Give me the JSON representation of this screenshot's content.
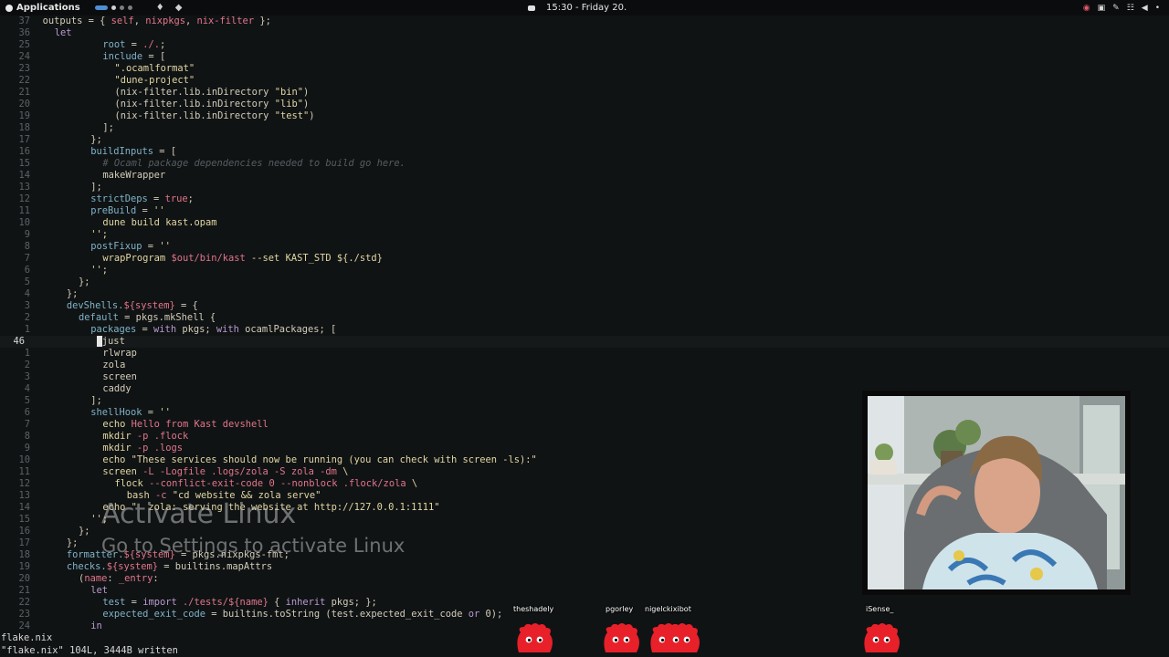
{
  "topbar": {
    "apps_label": "Applications",
    "clock": "15:30 - Friday 20.",
    "icons_left": [
      "droplet-icon",
      "diamond-icon"
    ],
    "tray_icons": [
      "record-icon",
      "gamepad-icon",
      "pen-icon",
      "network-icon",
      "volume-icon",
      "mic-icon"
    ]
  },
  "editor": {
    "lines": [
      {
        "n": "37",
        "c": [
          [
            "",
            "outputs = { "
          ],
          [
            "t-int",
            "self"
          ],
          [
            "",
            ", "
          ],
          [
            "t-int",
            "nixpkgs"
          ],
          [
            "",
            ", "
          ],
          [
            "t-int",
            "nix-filter"
          ],
          [
            "",
            " };"
          ]
        ],
        "indent": 1
      },
      {
        "n": "36",
        "c": [
          [
            "t-kw",
            "let"
          ]
        ],
        "indent": 3
      },
      {
        "n": "25",
        "c": [
          [
            "t-attr",
            "root"
          ],
          [
            "",
            " = "
          ],
          [
            "t-int",
            "./."
          ],
          [
            "",
            ";"
          ]
        ],
        "indent": 11
      },
      {
        "n": "24",
        "c": [
          [
            "t-attr",
            "include"
          ],
          [
            "",
            " = ["
          ]
        ],
        "indent": 11
      },
      {
        "n": "23",
        "c": [
          [
            "t-str",
            "\".ocamlformat\""
          ]
        ],
        "indent": 13
      },
      {
        "n": "22",
        "c": [
          [
            "t-str",
            "\"dune-project\""
          ]
        ],
        "indent": 13
      },
      {
        "n": "21",
        "c": [
          [
            "",
            "(nix-filter.lib.inDirectory "
          ],
          [
            "t-str",
            "\"bin\""
          ],
          [
            "",
            ")"
          ]
        ],
        "indent": 13
      },
      {
        "n": "20",
        "c": [
          [
            "",
            "(nix-filter.lib.inDirectory "
          ],
          [
            "t-str",
            "\"lib\""
          ],
          [
            "",
            ")"
          ]
        ],
        "indent": 13
      },
      {
        "n": "19",
        "c": [
          [
            "",
            "(nix-filter.lib.inDirectory "
          ],
          [
            "t-str",
            "\"test\""
          ],
          [
            "",
            ")"
          ]
        ],
        "indent": 13
      },
      {
        "n": "18",
        "c": [
          [
            "",
            "];"
          ]
        ],
        "indent": 11
      },
      {
        "n": "17",
        "c": [
          [
            "",
            "};"
          ]
        ],
        "indent": 9
      },
      {
        "n": "16",
        "c": [
          [
            "t-attr",
            "buildInputs"
          ],
          [
            "",
            " = ["
          ]
        ],
        "indent": 9
      },
      {
        "n": "15",
        "c": [
          [
            "t-com",
            "# Ocaml package dependencies needed to build go here."
          ]
        ],
        "indent": 11
      },
      {
        "n": "14",
        "c": [
          [
            "",
            "makeWrapper"
          ]
        ],
        "indent": 11
      },
      {
        "n": "13",
        "c": [
          [
            "",
            "];"
          ]
        ],
        "indent": 9
      },
      {
        "n": "12",
        "c": [
          [
            "t-attr",
            "strictDeps"
          ],
          [
            "",
            " = "
          ],
          [
            "t-int",
            "true"
          ],
          [
            "",
            ";"
          ]
        ],
        "indent": 9
      },
      {
        "n": "11",
        "c": [
          [
            "t-attr",
            "preBuild"
          ],
          [
            "",
            " = "
          ],
          [
            "t-str",
            "''"
          ]
        ],
        "indent": 9
      },
      {
        "n": "10",
        "c": [
          [
            "t-cmd",
            "dune build kast.opam"
          ]
        ],
        "indent": 11
      },
      {
        "n": "9",
        "c": [
          [
            "t-str",
            "'';"
          ]
        ],
        "indent": 9
      },
      {
        "n": "8",
        "c": [
          [
            "t-attr",
            "postFixup"
          ],
          [
            "",
            " = "
          ],
          [
            "t-str",
            "''"
          ]
        ],
        "indent": 9
      },
      {
        "n": "7",
        "c": [
          [
            "t-cmd",
            "wrapProgram "
          ],
          [
            "t-int",
            "$out/bin/kast"
          ],
          [
            "t-cmd",
            " --set KAST_STD ${./std}"
          ]
        ],
        "indent": 11
      },
      {
        "n": "6",
        "c": [
          [
            "t-str",
            "'';"
          ]
        ],
        "indent": 9
      },
      {
        "n": "5",
        "c": [
          [
            "",
            "};"
          ]
        ],
        "indent": 7
      },
      {
        "n": "4",
        "c": [
          [
            "",
            "};"
          ]
        ],
        "indent": 5
      },
      {
        "n": "3",
        "c": [
          [
            "t-attr",
            "devShells."
          ],
          [
            "t-int",
            "${system}"
          ],
          [
            "",
            " = {"
          ]
        ],
        "indent": 5
      },
      {
        "n": "2",
        "c": [
          [
            "t-attr",
            "default"
          ],
          [
            "",
            " = pkgs.mkShell {"
          ]
        ],
        "indent": 7
      },
      {
        "n": "1",
        "c": [
          [
            "t-attr",
            "packages"
          ],
          [
            "",
            " = "
          ],
          [
            "t-kw",
            "with"
          ],
          [
            "",
            " pkgs; "
          ],
          [
            "t-kw",
            "with"
          ],
          [
            "",
            " ocamlPackages; ["
          ]
        ],
        "indent": 9
      },
      {
        "n": "46",
        "c": [
          [
            "",
            "just"
          ]
        ],
        "indent": 11,
        "current": true
      },
      {
        "n": "1",
        "c": [
          [
            "",
            "rlwrap"
          ]
        ],
        "indent": 11
      },
      {
        "n": "2",
        "c": [
          [
            "",
            "zola"
          ]
        ],
        "indent": 11
      },
      {
        "n": "3",
        "c": [
          [
            "",
            "screen"
          ]
        ],
        "indent": 11
      },
      {
        "n": "4",
        "c": [
          [
            "",
            "caddy"
          ]
        ],
        "indent": 11
      },
      {
        "n": "5",
        "c": [
          [
            "",
            "];"
          ]
        ],
        "indent": 9
      },
      {
        "n": "6",
        "c": [
          [
            "t-attr",
            "shellHook"
          ],
          [
            "",
            " = "
          ],
          [
            "t-str",
            "''"
          ]
        ],
        "indent": 9
      },
      {
        "n": "7",
        "c": [
          [
            "t-cmd",
            "echo "
          ],
          [
            "t-int",
            "Hello from Kast devshell"
          ]
        ],
        "indent": 11
      },
      {
        "n": "8",
        "c": [
          [
            "t-cmd",
            "mkdir "
          ],
          [
            "t-int",
            "-p .flock"
          ]
        ],
        "indent": 11
      },
      {
        "n": "9",
        "c": [
          [
            "t-cmd",
            "mkdir "
          ],
          [
            "t-int",
            "-p .logs"
          ]
        ],
        "indent": 11
      },
      {
        "n": "10",
        "c": [
          [
            "t-cmd",
            "echo \"These services should now be running (you can check with screen -ls):\""
          ]
        ],
        "indent": 11
      },
      {
        "n": "11",
        "c": [
          [
            "t-cmd",
            "screen "
          ],
          [
            "t-int",
            "-L -Logfile .logs/zola -S zola -dm"
          ],
          [
            "t-cmd",
            " \\"
          ]
        ],
        "indent": 11
      },
      {
        "n": "12",
        "c": [
          [
            "t-cmd",
            "flock "
          ],
          [
            "t-int",
            "--conflict-exit-code 0 --nonblock .flock/zola"
          ],
          [
            "t-cmd",
            " \\"
          ]
        ],
        "indent": 13
      },
      {
        "n": "13",
        "c": [
          [
            "t-cmd",
            "bash "
          ],
          [
            "t-int",
            "-c"
          ],
          [
            "t-cmd",
            " \"cd website && zola serve\""
          ]
        ],
        "indent": 15
      },
      {
        "n": "14",
        "c": [
          [
            "t-cmd",
            "echo \"  zola: serving the website at http://127.0.0.1:1111\""
          ]
        ],
        "indent": 11
      },
      {
        "n": "15",
        "c": [
          [
            "t-str",
            "'';"
          ]
        ],
        "indent": 9
      },
      {
        "n": "16",
        "c": [
          [
            "",
            "};"
          ]
        ],
        "indent": 7
      },
      {
        "n": "17",
        "c": [
          [
            "",
            "};"
          ]
        ],
        "indent": 5
      },
      {
        "n": "18",
        "c": [
          [
            "t-attr",
            "formatter."
          ],
          [
            "t-int",
            "${system}"
          ],
          [
            "",
            " = pkgs.nixpkgs-fmt;"
          ]
        ],
        "indent": 5
      },
      {
        "n": "19",
        "c": [
          [
            "t-attr",
            "checks."
          ],
          [
            "t-int",
            "${system}"
          ],
          [
            "",
            " = builtins.mapAttrs"
          ]
        ],
        "indent": 5
      },
      {
        "n": "20",
        "c": [
          [
            "",
            "("
          ],
          [
            "t-int",
            "name"
          ],
          [
            "",
            ": "
          ],
          [
            "t-int",
            "_entry"
          ],
          [
            "",
            ":"
          ]
        ],
        "indent": 7
      },
      {
        "n": "21",
        "c": [
          [
            "t-kw",
            "let"
          ]
        ],
        "indent": 9
      },
      {
        "n": "22",
        "c": [
          [
            "t-attr",
            "test"
          ],
          [
            "",
            " = "
          ],
          [
            "t-kw",
            "import"
          ],
          [
            "",
            " "
          ],
          [
            "t-int",
            "./tests/${name}"
          ],
          [
            "",
            " { "
          ],
          [
            "t-kw",
            "inherit"
          ],
          [
            "",
            " pkgs; };"
          ]
        ],
        "indent": 11
      },
      {
        "n": "23",
        "c": [
          [
            "t-attr",
            "expected_exit_code"
          ],
          [
            "",
            " = builtins.toString (test.expected_exit_code "
          ],
          [
            "t-kw",
            "or"
          ],
          [
            "",
            " 0);"
          ]
        ],
        "indent": 11
      },
      {
        "n": "24",
        "c": [
          [
            "t-kw",
            "in"
          ]
        ],
        "indent": 9
      }
    ]
  },
  "status": {
    "filename": "flake.nix",
    "message": "\"flake.nix\" 104L, 3444B written"
  },
  "watermark": {
    "title": "Activate Linux",
    "subtitle": "Go to Settings to activate Linux"
  },
  "mascots": [
    {
      "label": "theshadely"
    },
    {
      "label": "pgorley"
    },
    {
      "label": "nigelckixibot"
    },
    {
      "label": ""
    },
    {
      "label": "iSense_"
    }
  ],
  "colors": {
    "background": "#101314",
    "mascot": "#e8202a",
    "keyword": "#b99ad1",
    "attribute": "#7fb3c9",
    "string": "#e2d7a3",
    "interpolation": "#e2758c"
  }
}
